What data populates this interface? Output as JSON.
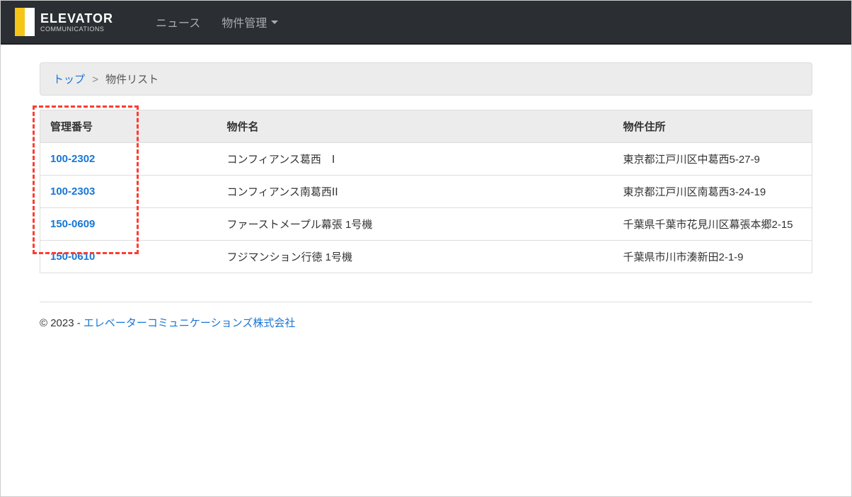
{
  "brand": {
    "main": "ELEVATOR",
    "sub": "COMMUNICATIONS"
  },
  "nav": {
    "news": "ニュース",
    "property_mgmt": "物件管理"
  },
  "breadcrumb": {
    "top": "トップ",
    "sep": ">",
    "current": "物件リスト"
  },
  "table": {
    "headers": {
      "id": "管理番号",
      "name": "物件名",
      "address": "物件住所"
    },
    "rows": [
      {
        "id": "100-2302",
        "name": "コンフィアンス葛西　Ⅰ",
        "address": "東京都江戸川区中葛西5-27-9"
      },
      {
        "id": "100-2303",
        "name": "コンフィアンス南葛西ⅠⅠ",
        "address": "東京都江戸川区南葛西3-24-19"
      },
      {
        "id": "150-0609",
        "name": "ファーストメープル幕張 1号機",
        "address": "千葉県千葉市花見川区幕張本郷2-15"
      },
      {
        "id": "150-0610",
        "name": "フジマンション行徳 1号機",
        "address": "千葉県市川市湊新田2-1-9"
      }
    ]
  },
  "footer": {
    "prefix": "© 2023 - ",
    "link": "エレベーターコミュニケーションズ株式会社"
  }
}
